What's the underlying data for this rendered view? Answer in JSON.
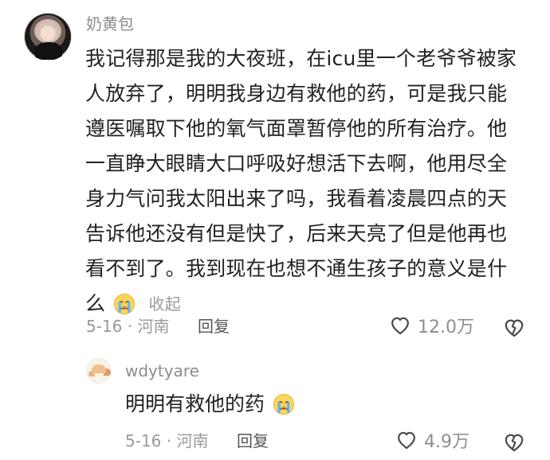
{
  "main_comment": {
    "username": "奶黄包",
    "lines": [
      "我记得那是我的大夜班，在icu里一个老爷爷被家",
      "人放弃了，明明我身边有救他的药，可是我只能",
      "遵医嘱取下他的氧气面罩暂停他的所有治疗。他",
      "一直睁大眼睛大口呼吸好想活下去啊，他用尽全",
      "身力气问我太阳出来了吗，我看着凌晨四点的天",
      "告诉他还没有但是快了，后来天亮了但是他再也",
      "看不到了。我到现在也想不通生孩子的意义是什",
      "么"
    ],
    "collapse_label": "收起",
    "meta": "5-16 · 河南",
    "reply_label": "回复",
    "like_count": "12.0万",
    "icons": {
      "avatar": "female-avatar",
      "emoji": "crying-face-emoji",
      "like": "heart-icon",
      "dislike": "broken-heart-icon"
    }
  },
  "reply_comment": {
    "username": "wdytyare",
    "text": "明明有救他的药",
    "meta": "5-16 · 河南",
    "reply_label": "回复",
    "like_count": "4.9万",
    "icons": {
      "avatar": "cat-avatar",
      "emoji": "crying-face-emoji",
      "like": "heart-icon",
      "dislike": "broken-heart-icon"
    }
  },
  "colors": {
    "text": "#222222",
    "muted": "#999999",
    "username": "#8d8d8d",
    "icon": "#8e8e8e"
  }
}
